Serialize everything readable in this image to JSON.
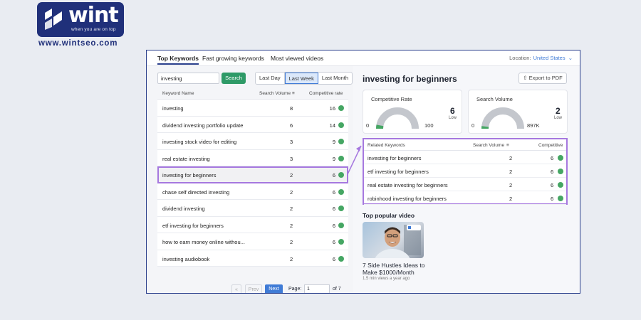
{
  "brand": {
    "logo_text": "wint",
    "tagline": "when you are on top",
    "url": "www.wintseo.com"
  },
  "tabs": [
    {
      "label": "Top Keywords",
      "active": true
    },
    {
      "label": "Fast growing keywords",
      "active": false
    },
    {
      "label": "Most viewed videos",
      "active": false
    }
  ],
  "location": {
    "label": "Location:",
    "value": "United States",
    "icon": "chevron-down-icon"
  },
  "search": {
    "value": "investing",
    "button": "Search"
  },
  "range": {
    "options": [
      "Last Day",
      "Last Week",
      "Last Month"
    ],
    "selected": "Last Week"
  },
  "keywords_table": {
    "headers": {
      "keyword": "Keyword Name",
      "volume": "Search Volume",
      "competitive": "Competitive rate"
    },
    "rows": [
      {
        "keyword": "investing",
        "volume": "8",
        "competitive": "16"
      },
      {
        "keyword": "dividend investing portfolio update",
        "volume": "6",
        "competitive": "14"
      },
      {
        "keyword": "investing stock video for editing",
        "volume": "3",
        "competitive": "9"
      },
      {
        "keyword": "real estate investing",
        "volume": "3",
        "competitive": "9"
      },
      {
        "keyword": "investing for beginners",
        "volume": "2",
        "competitive": "6"
      },
      {
        "keyword": "chase self directed investing",
        "volume": "2",
        "competitive": "6"
      },
      {
        "keyword": "dividend investing",
        "volume": "2",
        "competitive": "6"
      },
      {
        "keyword": "etf investing for beginners",
        "volume": "2",
        "competitive": "6"
      },
      {
        "keyword": "how to earn money online withou...",
        "volume": "2",
        "competitive": "6"
      },
      {
        "keyword": "investing audiobook",
        "volume": "2",
        "competitive": "6"
      }
    ],
    "highlighted_row": "investing for beginners"
  },
  "pagination": {
    "first": "«",
    "prev": "Prev",
    "next": "Next",
    "page_label": "Page:",
    "page": "1",
    "of": "of 7"
  },
  "detail": {
    "title": "investing for beginners",
    "export_button": "Export to PDF",
    "competitive": {
      "title": "Competitive Rate",
      "min": "0",
      "max": "100",
      "value": "6",
      "level": "Low",
      "fraction": 0.06
    },
    "volume": {
      "title": "Search Volume",
      "min": "0",
      "max": "897K",
      "value": "2",
      "level": "Low",
      "fraction": 0.03
    },
    "related": {
      "headers": {
        "keyword": "Related Keywords",
        "volume": "Search Volume",
        "competitive": "Competitive"
      },
      "rows": [
        {
          "keyword": "investing for beginners",
          "volume": "2",
          "competitive": "6"
        },
        {
          "keyword": "etf investing for beginners",
          "volume": "2",
          "competitive": "6"
        },
        {
          "keyword": "real estate investing for beginners",
          "volume": "2",
          "competitive": "6"
        },
        {
          "keyword": "robinhood investing for beginners",
          "volume": "2",
          "competitive": "6"
        }
      ]
    },
    "popular": {
      "title": "Top popular video",
      "video_title": "7 Side Hustles Ideas to Make $1000/Month",
      "meta": "1.5 min views a year ago"
    }
  },
  "colors": {
    "brand": "#20307a",
    "accent": "#3f7bd6",
    "green": "#45a663",
    "highlight": "#a678df",
    "search_button": "#2e9a67"
  }
}
